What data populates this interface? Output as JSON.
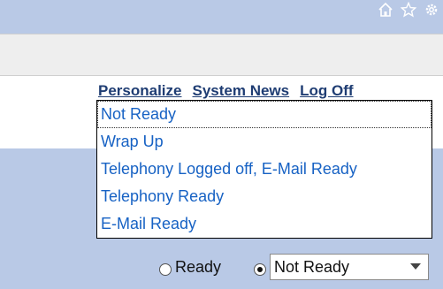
{
  "header": {
    "icons": [
      "home-icon",
      "star-icon",
      "gear-icon"
    ],
    "links": [
      "Personalize",
      "System News",
      "Log Off"
    ]
  },
  "status_menu": {
    "items": [
      "Not Ready",
      "Wrap Up",
      "Telephony Logged off, E-Mail Ready",
      "Telephony Ready",
      "E-Mail Ready"
    ]
  },
  "footer": {
    "ready_label": "Ready",
    "not_ready_selected": true,
    "select_value": "Not Ready"
  },
  "colors": {
    "bar": "#b9c9e6",
    "link": "#1f3d73",
    "menu_text": "#1762c4"
  }
}
